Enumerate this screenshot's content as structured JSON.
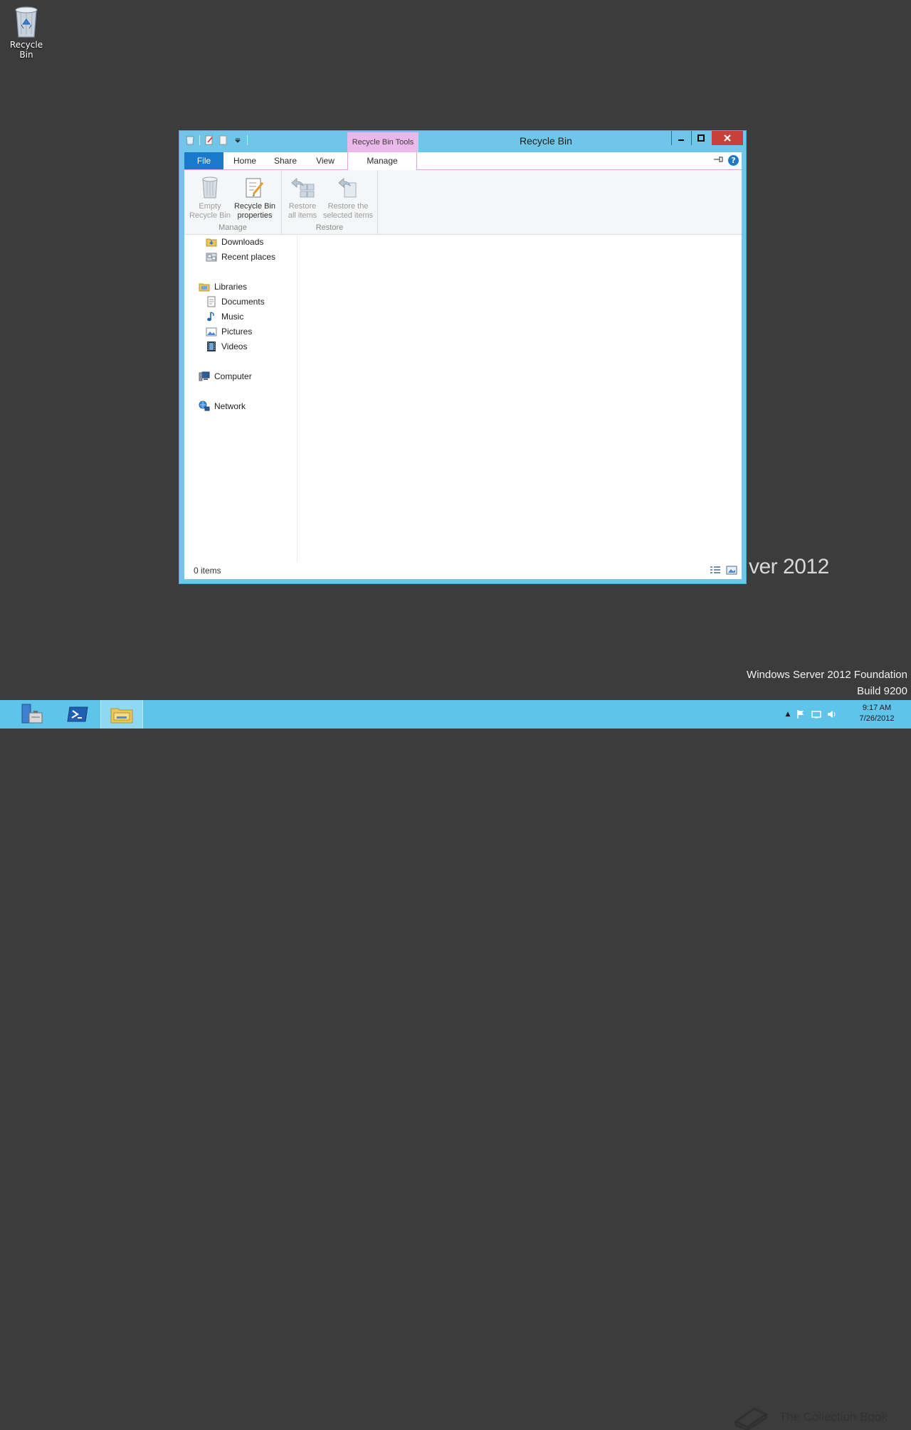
{
  "desktop": {
    "recycle_bin_label": "Recycle Bin"
  },
  "watermark": {
    "brand_fragment": "ver 2012",
    "edition": "Windows Server 2012 Foundation",
    "build": "Build 9200",
    "overlay": "The Collection Book"
  },
  "window": {
    "title": "Recycle Bin",
    "contextual_tab_group": "Recycle Bin Tools",
    "controls": {
      "minimize": "–",
      "maximize": "□",
      "close": "✕"
    }
  },
  "ribbon": {
    "tabs": [
      "File",
      "Home",
      "Share",
      "View",
      "Manage"
    ],
    "groups": {
      "manage": {
        "label": "Manage",
        "buttons": [
          {
            "line1": "Empty",
            "line2": "Recycle Bin",
            "enabled": false
          },
          {
            "line1": "Recycle Bin",
            "line2": "properties",
            "enabled": true
          }
        ]
      },
      "restore": {
        "label": "Restore",
        "buttons": [
          {
            "line1": "Restore",
            "line2": "all items",
            "enabled": false
          },
          {
            "line1": "Restore the",
            "line2": "selected items",
            "enabled": false
          }
        ]
      }
    }
  },
  "navigation": {
    "items": [
      {
        "label": "Downloads",
        "icon": "downloads-folder-icon"
      },
      {
        "label": "Recent places",
        "icon": "recent-places-icon"
      },
      {
        "label": "Libraries",
        "icon": "libraries-icon"
      },
      {
        "label": "Documents",
        "icon": "documents-icon"
      },
      {
        "label": "Music",
        "icon": "music-icon"
      },
      {
        "label": "Pictures",
        "icon": "pictures-icon"
      },
      {
        "label": "Videos",
        "icon": "videos-icon"
      },
      {
        "label": "Computer",
        "icon": "computer-icon"
      },
      {
        "label": "Network",
        "icon": "network-icon"
      }
    ]
  },
  "status": {
    "item_count": "0 items"
  },
  "taskbar": {
    "clock_time": "9:17 AM",
    "clock_date": "7/26/2012"
  },
  "colors": {
    "window_frame": "#6fc6e8",
    "file_tab": "#1979ca",
    "contextual_tab": "#ebb8ec",
    "close_button": "#c7413a",
    "taskbar": "#5fc4ea",
    "desktop": "#3c3c3c"
  }
}
